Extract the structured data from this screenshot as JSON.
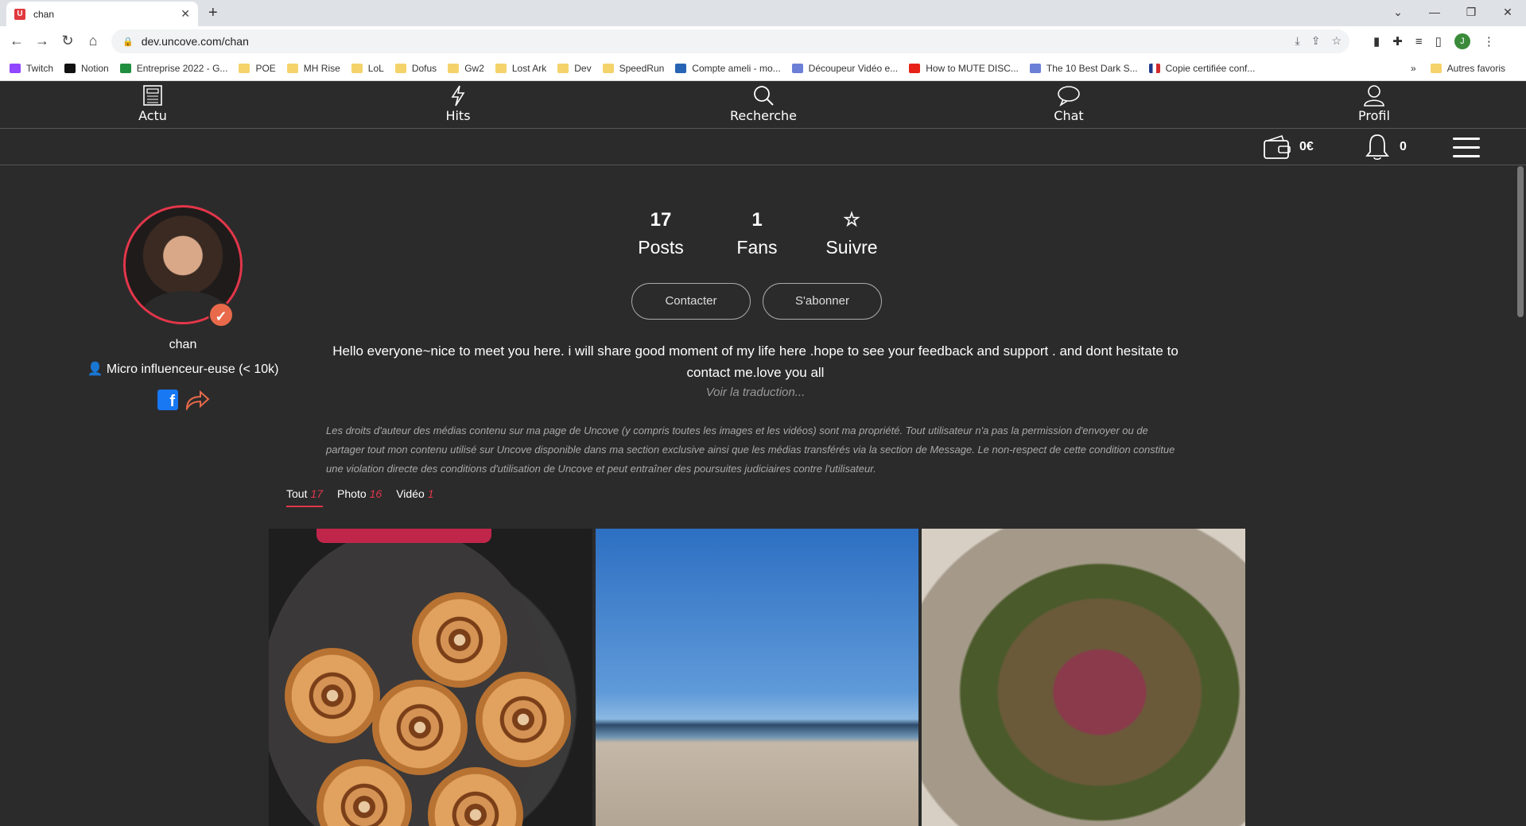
{
  "browser": {
    "tab_title": "chan",
    "tab_favicon": "U",
    "new_tab": "+",
    "url": "dev.uncove.com/chan",
    "profile_initial": "J",
    "bookmarks": [
      {
        "label": "Twitch",
        "icon": "twitch"
      },
      {
        "label": "Notion",
        "icon": "notion"
      },
      {
        "label": "Entreprise 2022 - G...",
        "icon": "sheet"
      },
      {
        "label": "POE",
        "icon": "folder"
      },
      {
        "label": "MH Rise",
        "icon": "folder"
      },
      {
        "label": "LoL",
        "icon": "folder"
      },
      {
        "label": "Dofus",
        "icon": "folder"
      },
      {
        "label": "Gw2",
        "icon": "folder"
      },
      {
        "label": "Lost Ark",
        "icon": "folder"
      },
      {
        "label": "Dev",
        "icon": "folder"
      },
      {
        "label": "SpeedRun",
        "icon": "folder"
      },
      {
        "label": "Compte ameli - mo...",
        "icon": "ameli"
      },
      {
        "label": "Découpeur Vidéo e...",
        "icon": "misc"
      },
      {
        "label": "How to MUTE DISC...",
        "icon": "yt"
      },
      {
        "label": "The 10 Best Dark S...",
        "icon": "misc"
      },
      {
        "label": "Copie certifiée conf...",
        "icon": "fr"
      }
    ],
    "bookmarks_more": "»",
    "other_bookmarks": "Autres favoris"
  },
  "app": {
    "nav": [
      {
        "label": "Actu",
        "icon": "newspaper-icon"
      },
      {
        "label": "Hits",
        "icon": "lightning-icon"
      },
      {
        "label": "Recherche",
        "icon": "search-icon"
      },
      {
        "label": "Chat",
        "icon": "chat-bubble-icon"
      },
      {
        "label": "Profil",
        "icon": "user-icon"
      }
    ],
    "wallet_amount": "0€",
    "notifications_count": "0",
    "accent_color": "#e3364a",
    "background_color": "#2b2b2b"
  },
  "profile": {
    "username": "chan",
    "category": "Micro influenceur-euse (< 10k)",
    "stats": {
      "posts_count": "17",
      "posts_label": "Posts",
      "fans_count": "1",
      "fans_label": "Fans",
      "follow_label": "Suivre"
    },
    "contact_label": "Contacter",
    "subscribe_label": "S'abonner",
    "bio": "Hello everyone~nice to meet you here. i will share good moment of my life here .hope to see your feedback and support . and dont hesitate to contact me.love you all",
    "translate_label": "Voir la traduction...",
    "disclaimer": "Les droits d'auteur des médias contenu sur ma page de Uncove (y compris toutes les images et les vidéos) sont ma propriété. Tout utilisateur n'a pas la permission d'envoyer ou de partager tout mon contenu utilisé sur Uncove disponible dans ma section exclusive ainsi que les médias transférés via la section de Message. Le non-respect de cette condition constitue une violation directe des conditions d'utilisation de Uncove et peut entraîner des poursuites judiciaires contre l'utilisateur.",
    "filters": [
      {
        "label": "Tout",
        "count": "17",
        "active": true
      },
      {
        "label": "Photo",
        "count": "16",
        "active": false
      },
      {
        "label": "Vidéo",
        "count": "1",
        "active": false
      }
    ]
  }
}
